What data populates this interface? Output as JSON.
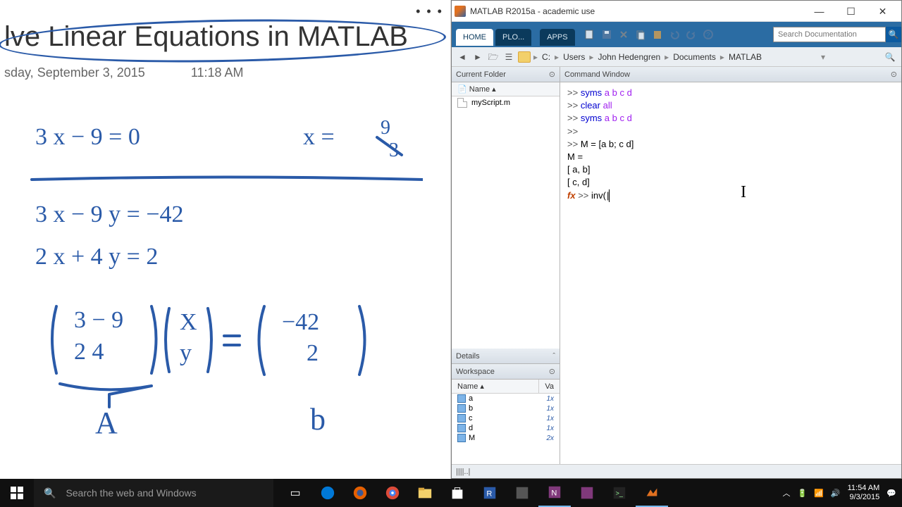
{
  "notes": {
    "more": "• • •",
    "title": "lve Linear Equations in MATLAB",
    "date": "sday, September 3, 2015",
    "time": "11:18 AM"
  },
  "matlab": {
    "title": "MATLAB R2015a - academic use",
    "tabs": {
      "home": "HOME",
      "plots": "PLO...",
      "apps": "APPS"
    },
    "search_placeholder": "Search Documentation",
    "breadcrumb": [
      "C:",
      "Users",
      "John Hedengren",
      "Documents",
      "MATLAB"
    ],
    "panels": {
      "currentFolder": "Current Folder",
      "nameHeader": "Name ▴",
      "files": [
        "myScript.m"
      ],
      "details": "Details",
      "workspace": "Workspace",
      "wsNameHeader": "Name ▴",
      "wsValHeader": "Va",
      "wsItems": [
        {
          "name": "a",
          "val": "1x"
        },
        {
          "name": "b",
          "val": "1x"
        },
        {
          "name": "c",
          "val": "1x"
        },
        {
          "name": "d",
          "val": "1x"
        },
        {
          "name": "M",
          "val": "2x"
        }
      ],
      "commandWindow": "Command Window"
    },
    "cmd": {
      "l1_prompt": ">>",
      "l1_kw": "syms",
      "l1_args": "a b c d",
      "l2_prompt": ">>",
      "l2_kw": "clear",
      "l2_args": "all",
      "l3_prompt": ">>",
      "l3_kw": "syms",
      "l3_args": "a b c d",
      "l4_prompt": ">>",
      "l5_prompt": ">>",
      "l5_text": "M = [a b; c d]",
      "blank": " ",
      "l6": "M =",
      "l7": "[ a, b]",
      "l8": "[ c, d]",
      "fx": "fx",
      "l9_prompt": ">>",
      "l9_text": "inv("
    },
    "status": "||||..|"
  },
  "taskbar": {
    "search_placeholder": "Search the web and Windows",
    "time": "11:54 AM",
    "date": "9/3/2015",
    "tray_chevron": "︿"
  }
}
